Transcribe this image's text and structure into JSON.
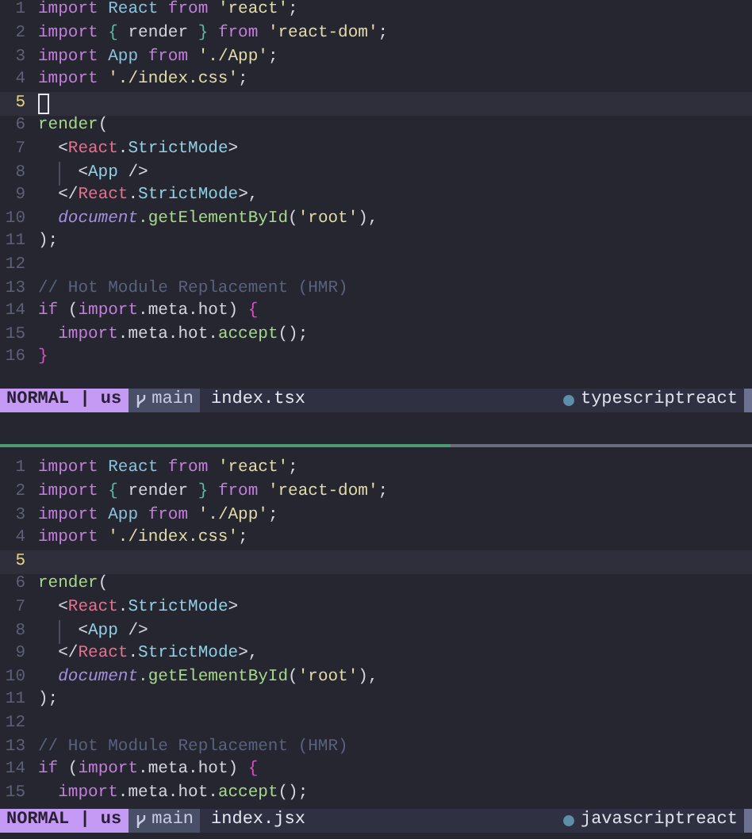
{
  "panes": [
    {
      "focused": true,
      "lines": [
        {
          "number": "1",
          "tokens": [
            {
              "text": "import ",
              "kind": "keyword"
            },
            {
              "text": "React ",
              "kind": "ident"
            },
            {
              "text": "from ",
              "kind": "keyword"
            },
            {
              "text": "'react'",
              "kind": "string"
            },
            {
              "text": ";",
              "kind": "plain"
            }
          ]
        },
        {
          "number": "2",
          "tokens": [
            {
              "text": "import ",
              "kind": "keyword"
            },
            {
              "text": "{ ",
              "kind": "brace"
            },
            {
              "text": "render ",
              "kind": "plain"
            },
            {
              "text": "} ",
              "kind": "brace"
            },
            {
              "text": "from ",
              "kind": "keyword"
            },
            {
              "text": "'react-dom'",
              "kind": "string"
            },
            {
              "text": ";",
              "kind": "plain"
            }
          ]
        },
        {
          "number": "3",
          "tokens": [
            {
              "text": "import ",
              "kind": "keyword"
            },
            {
              "text": "App ",
              "kind": "ident"
            },
            {
              "text": "from ",
              "kind": "keyword"
            },
            {
              "text": "'./App'",
              "kind": "string"
            },
            {
              "text": ";",
              "kind": "plain"
            }
          ]
        },
        {
          "number": "4",
          "tokens": [
            {
              "text": "import ",
              "kind": "keyword"
            },
            {
              "text": "'./index.css'",
              "kind": "string"
            },
            {
              "text": ";",
              "kind": "plain"
            }
          ]
        },
        {
          "number": "5",
          "current": true
        },
        {
          "number": "6",
          "tokens": [
            {
              "text": "render",
              "kind": "func"
            },
            {
              "text": "(",
              "kind": "plain"
            }
          ]
        },
        {
          "number": "7",
          "tokens": [
            {
              "text": "  <",
              "kind": "plain"
            },
            {
              "text": "React",
              "kind": "tag"
            },
            {
              "text": ".",
              "kind": "plain"
            },
            {
              "text": "StrictMode",
              "kind": "component"
            },
            {
              "text": ">",
              "kind": "plain"
            }
          ]
        },
        {
          "number": "8",
          "indent_guide": true,
          "tokens": [
            {
              "text": "<",
              "kind": "plain"
            },
            {
              "text": "App",
              "kind": "component"
            },
            {
              "text": " />",
              "kind": "plain"
            }
          ]
        },
        {
          "number": "9",
          "tokens": [
            {
              "text": "  </",
              "kind": "plain"
            },
            {
              "text": "React",
              "kind": "tag"
            },
            {
              "text": ".",
              "kind": "plain"
            },
            {
              "text": "StrictMode",
              "kind": "component"
            },
            {
              "text": ">,",
              "kind": "plain"
            }
          ]
        },
        {
          "number": "10",
          "tokens": [
            {
              "text": "  document",
              "kind": "var"
            },
            {
              "text": ".getElementById",
              "kind": "func"
            },
            {
              "text": "(",
              "kind": "plain"
            },
            {
              "text": "'root'",
              "kind": "string"
            },
            {
              "text": "),",
              "kind": "plain"
            }
          ]
        },
        {
          "number": "11",
          "tokens": [
            {
              "text": ");",
              "kind": "plain"
            }
          ]
        },
        {
          "number": "12"
        },
        {
          "number": "13",
          "tokens": [
            {
              "text": "// Hot Module Replacement (HMR)",
              "kind": "comment"
            }
          ]
        },
        {
          "number": "14",
          "tokens": [
            {
              "text": "if ",
              "kind": "keyword"
            },
            {
              "text": "(",
              "kind": "plain"
            },
            {
              "text": "import",
              "kind": "keyword"
            },
            {
              "text": ".meta.hot) ",
              "kind": "plain"
            },
            {
              "text": "{",
              "kind": "magenta"
            }
          ]
        },
        {
          "number": "15",
          "tokens": [
            {
              "text": "  import",
              "kind": "keyword"
            },
            {
              "text": ".meta.hot.",
              "kind": "plain"
            },
            {
              "text": "accept",
              "kind": "func"
            },
            {
              "text": "();",
              "kind": "plain"
            }
          ]
        },
        {
          "number": "16",
          "tokens": [
            {
              "text": "}",
              "kind": "magenta"
            }
          ]
        }
      ],
      "status": {
        "mode": "NORMAL | us",
        "branch": "main",
        "file": "index.tsx",
        "filetype": "typescriptreact"
      }
    },
    {
      "focused": false,
      "lines": [
        {
          "number": "1",
          "tokens": [
            {
              "text": "import ",
              "kind": "keyword"
            },
            {
              "text": "React ",
              "kind": "ident"
            },
            {
              "text": "from ",
              "kind": "keyword"
            },
            {
              "text": "'react'",
              "kind": "string"
            },
            {
              "text": ";",
              "kind": "plain"
            }
          ]
        },
        {
          "number": "2",
          "tokens": [
            {
              "text": "import ",
              "kind": "keyword"
            },
            {
              "text": "{ ",
              "kind": "brace"
            },
            {
              "text": "render ",
              "kind": "plain"
            },
            {
              "text": "} ",
              "kind": "brace"
            },
            {
              "text": "from ",
              "kind": "keyword"
            },
            {
              "text": "'react-dom'",
              "kind": "string"
            },
            {
              "text": ";",
              "kind": "plain"
            }
          ]
        },
        {
          "number": "3",
          "tokens": [
            {
              "text": "import ",
              "kind": "keyword"
            },
            {
              "text": "App ",
              "kind": "ident"
            },
            {
              "text": "from ",
              "kind": "keyword"
            },
            {
              "text": "'./App'",
              "kind": "string"
            },
            {
              "text": ";",
              "kind": "plain"
            }
          ]
        },
        {
          "number": "4",
          "tokens": [
            {
              "text": "import ",
              "kind": "keyword"
            },
            {
              "text": "'./index.css'",
              "kind": "string"
            },
            {
              "text": ";",
              "kind": "plain"
            }
          ]
        },
        {
          "number": "5",
          "current": true
        },
        {
          "number": "6",
          "tokens": [
            {
              "text": "render",
              "kind": "func"
            },
            {
              "text": "(",
              "kind": "plain"
            }
          ]
        },
        {
          "number": "7",
          "tokens": [
            {
              "text": "  <",
              "kind": "plain"
            },
            {
              "text": "React",
              "kind": "tag"
            },
            {
              "text": ".",
              "kind": "plain"
            },
            {
              "text": "StrictMode",
              "kind": "component"
            },
            {
              "text": ">",
              "kind": "plain"
            }
          ]
        },
        {
          "number": "8",
          "indent_guide": true,
          "tokens": [
            {
              "text": "<",
              "kind": "plain"
            },
            {
              "text": "App",
              "kind": "component"
            },
            {
              "text": " />",
              "kind": "plain"
            }
          ]
        },
        {
          "number": "9",
          "tokens": [
            {
              "text": "  </",
              "kind": "plain"
            },
            {
              "text": "React",
              "kind": "tag"
            },
            {
              "text": ".",
              "kind": "plain"
            },
            {
              "text": "StrictMode",
              "kind": "component"
            },
            {
              "text": ">,",
              "kind": "plain"
            }
          ]
        },
        {
          "number": "10",
          "tokens": [
            {
              "text": "  document",
              "kind": "var"
            },
            {
              "text": ".getElementById",
              "kind": "func"
            },
            {
              "text": "(",
              "kind": "plain"
            },
            {
              "text": "'root'",
              "kind": "string"
            },
            {
              "text": "),",
              "kind": "plain"
            }
          ]
        },
        {
          "number": "11",
          "tokens": [
            {
              "text": ");",
              "kind": "plain"
            }
          ]
        },
        {
          "number": "12"
        },
        {
          "number": "13",
          "tokens": [
            {
              "text": "// Hot Module Replacement (HMR)",
              "kind": "comment"
            }
          ]
        },
        {
          "number": "14",
          "tokens": [
            {
              "text": "if ",
              "kind": "keyword"
            },
            {
              "text": "(",
              "kind": "plain"
            },
            {
              "text": "import",
              "kind": "keyword"
            },
            {
              "text": ".meta.hot) ",
              "kind": "plain"
            },
            {
              "text": "{",
              "kind": "magenta"
            }
          ]
        },
        {
          "number": "15",
          "tokens": [
            {
              "text": "  import",
              "kind": "keyword"
            },
            {
              "text": ".meta.hot.",
              "kind": "plain"
            },
            {
              "text": "accept",
              "kind": "func"
            },
            {
              "text": "();",
              "kind": "plain"
            }
          ]
        }
      ],
      "status": {
        "mode": "NORMAL | us",
        "branch": "main",
        "file": "index.jsx",
        "filetype": "javascriptreact"
      }
    }
  ],
  "divider": {
    "level": 0.6
  }
}
